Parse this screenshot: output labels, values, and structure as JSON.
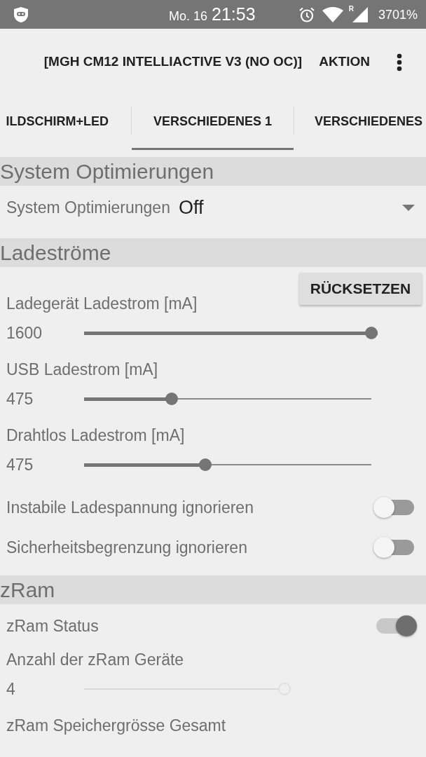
{
  "status_bar": {
    "date": "Mo. 16",
    "time": "21:53",
    "roaming": "R",
    "battery": "3701%"
  },
  "action_bar": {
    "title": "[MGH CM12 INTELLIACTIVE V3 (NO OC)]",
    "action": "AKTION"
  },
  "tabs": [
    {
      "label": "ILDSCHIRM+LED",
      "selected": false
    },
    {
      "label": "VERSCHIEDENES 1",
      "selected": true
    },
    {
      "label": "VERSCHIEDENES",
      "selected": false
    }
  ],
  "sections": [
    {
      "title": "System Optimierungen",
      "items": [
        {
          "kind": "dropdown",
          "label": "System Optimierungen",
          "value": "Off"
        }
      ]
    },
    {
      "title": "Ladeströme",
      "button": "RÜCKSETZEN",
      "items": [
        {
          "kind": "slider",
          "label": "Ladegerät Ladestrom [mA]",
          "value": "1600",
          "level": 1,
          "disabled": false
        },
        {
          "kind": "slider",
          "label": "USB Ladestrom [mA]",
          "value": "475",
          "level": 0.29,
          "disabled": false
        },
        {
          "kind": "slider",
          "label": "Drahtlos Ladestrom [mA]",
          "value": "475",
          "level": 0.41,
          "disabled": false
        },
        {
          "kind": "switch",
          "label": "Instabile Ladespannung ignorieren",
          "on": false
        },
        {
          "kind": "switch",
          "label": "Sicherheitsbegrenzung ignorieren",
          "on": false
        }
      ]
    },
    {
      "title": "zRam",
      "items": [
        {
          "kind": "switch",
          "label": "zRam Status",
          "on": true
        },
        {
          "kind": "slider",
          "label": "Anzahl der zRam Geräte",
          "value": "4",
          "level": 0.69,
          "disabled": true
        },
        {
          "kind": "label",
          "label": "zRam Speichergrösse Gesamt"
        }
      ]
    }
  ]
}
